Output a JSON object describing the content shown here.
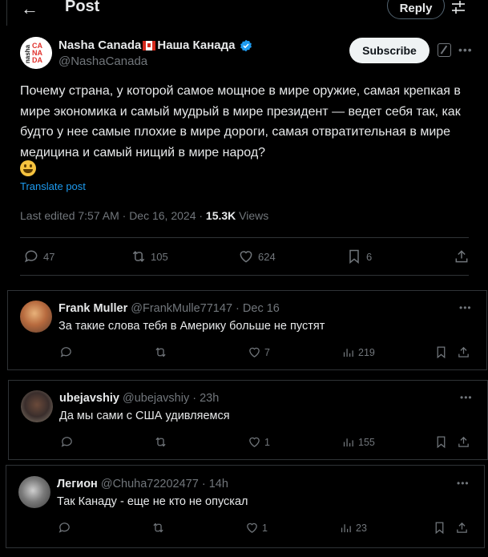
{
  "header": {
    "title": "Post",
    "back_icon": "arrow-left-icon",
    "reply_label": "Reply",
    "filter_icon": "sliders-icon"
  },
  "post": {
    "author": {
      "display_name_en": "Nasha Canada",
      "flag": "canada-flag",
      "display_name_ru": "Наша Канада",
      "verified": true,
      "handle": "@NashaCanada",
      "avatar_text": "nasha CANADA"
    },
    "subscribe_label": "Subscribe",
    "text": "Почему страна, у которой самое мощное в мире оружие, самая крепкая в мире экономика и самый мудрый в мире президент — ведет себя так, как будто у нее самые плохие в мире дороги, самая отвратительная в мире медицина и самый нищий в мире народ?",
    "emoji": "grinning-face",
    "translate_label": "Translate post",
    "meta": {
      "edited_prefix": "Last edited 7:57 AM · Dec 16, 2024 · ",
      "views_count": "15.3K",
      "views_label": " Views"
    },
    "stats": {
      "replies": "47",
      "reposts": "105",
      "likes": "624",
      "bookmarks": "6"
    }
  },
  "replies": [
    {
      "name": "Frank Muller",
      "handle": "@FrankMulle77147",
      "time": "· Dec 16",
      "text": "За такие слова тебя в Америку больше не пустят",
      "replies": "",
      "reposts": "",
      "likes": "7",
      "views": "219"
    },
    {
      "name": "ubejavshiy",
      "handle": "@ubejavshiy",
      "time": "· 23h",
      "text": "Да мы сами с США удивляемся",
      "replies": "",
      "reposts": "",
      "likes": "1",
      "views": "155"
    },
    {
      "name": "Легион",
      "handle": "@Chuha72202477",
      "time": "· 14h",
      "text": "Так Канаду - еще не кто не опускал",
      "replies": "",
      "reposts": "",
      "likes": "1",
      "views": "23"
    }
  ],
  "colors": {
    "background": "#000000",
    "text_primary": "#e7e9ea",
    "text_secondary": "#71767b",
    "link": "#1d9bf0",
    "border": "#2f3336",
    "verified": "#1d9bf0"
  }
}
